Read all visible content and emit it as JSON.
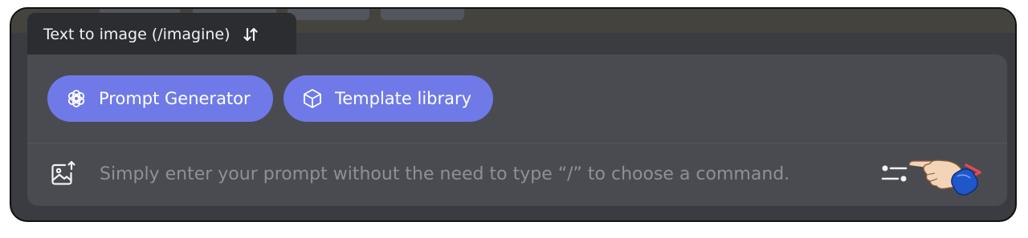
{
  "mode_tab": {
    "label": "Text to image (/imagine)",
    "switch_icon": "swap-vertical-icon"
  },
  "chips": [
    {
      "label": "Prompt Generator",
      "icon": "openai-logo-icon"
    },
    {
      "label": "Template library",
      "icon": "cube-icon"
    }
  ],
  "prompt": {
    "placeholder": "Simply enter your prompt without the need to type “/” to choose a command.",
    "value": ""
  },
  "icons": {
    "upload": "image-upload-icon",
    "settings": "sliders-icon",
    "send": "send-arrow-icon",
    "pointer": "hand-pointer-icon"
  },
  "colors": {
    "accent": "#6f7ae8",
    "panel": "#4a4b51",
    "tab": "#2c2d31",
    "send": "#e5484d"
  }
}
